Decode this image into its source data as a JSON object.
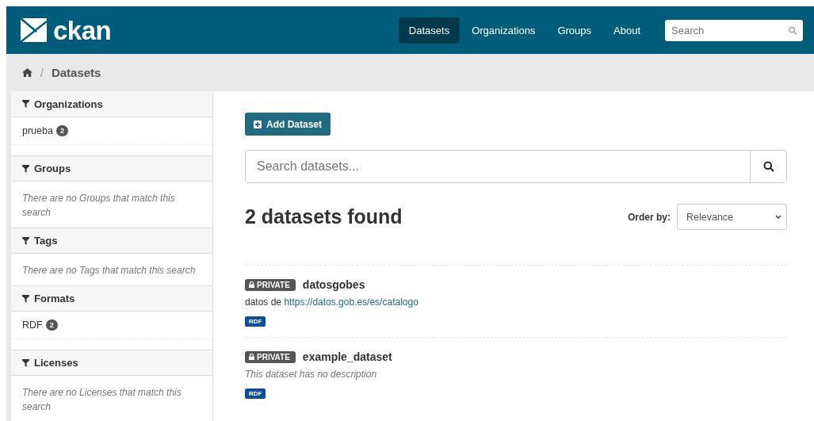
{
  "header": {
    "logo": "ckan",
    "nav": [
      {
        "label": "Datasets",
        "selected": true
      },
      {
        "label": "Organizations",
        "selected": false
      },
      {
        "label": "Groups",
        "selected": false
      },
      {
        "label": "About",
        "selected": false
      }
    ],
    "search": {
      "placeholder": "Search"
    }
  },
  "breadcrumb": {
    "separator": "/",
    "current": "Datasets"
  },
  "facets": [
    {
      "title": "Organizations",
      "items": [
        {
          "label": "prueba",
          "count": "2"
        }
      ]
    },
    {
      "title": "Groups",
      "empty_message": "There are no Groups that match this search"
    },
    {
      "title": "Tags",
      "empty_message": "There are no Tags that match this search"
    },
    {
      "title": "Formats",
      "items": [
        {
          "label": "RDF",
          "count": "2"
        }
      ]
    },
    {
      "title": "Licenses",
      "empty_message": "There are no Licenses that match this search"
    }
  ],
  "add_button": "Add Dataset",
  "dataset_search": {
    "placeholder": "Search datasets..."
  },
  "results_heading": "2 datasets found",
  "order_by": {
    "label": "Order by:",
    "value": "Relevance"
  },
  "datasets": [
    {
      "badge": "PRIVATE",
      "title": "datosgobes",
      "description": {
        "kind": "text",
        "text": "datos de ",
        "link": "https://datos.gob.es/es/catalogo"
      },
      "formats": [
        "RDF"
      ]
    },
    {
      "badge": "PRIVATE",
      "title": "example_dataset",
      "description": {
        "kind": "empty",
        "text": "This dataset has no description"
      },
      "formats": [
        "RDF"
      ]
    }
  ]
}
